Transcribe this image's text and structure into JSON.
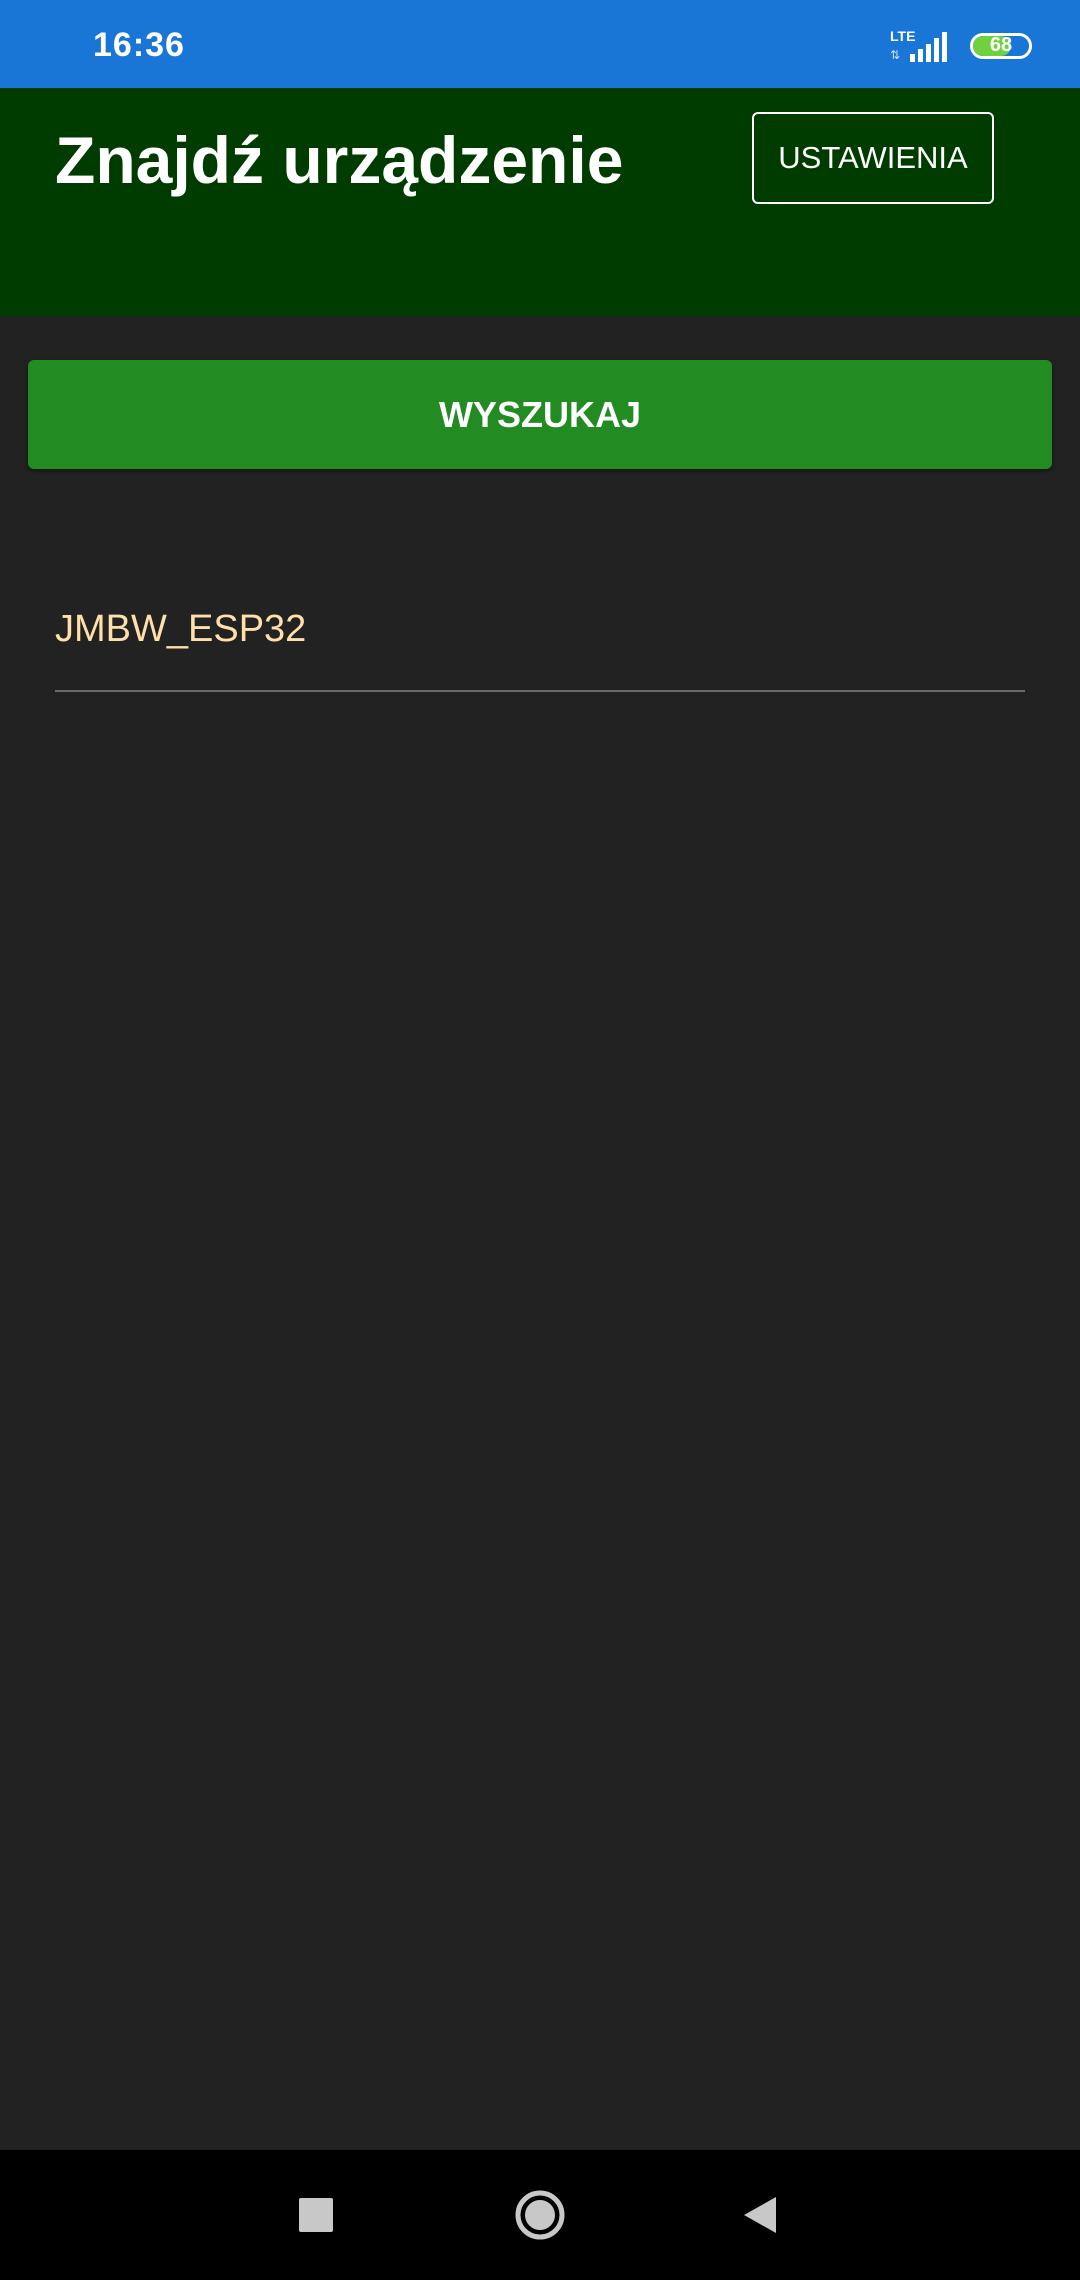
{
  "status_bar": {
    "time": "16:36",
    "network_type": "LTE",
    "data_arrows": "⇅",
    "battery_level": "68",
    "battery_fraction": 0.68,
    "colors": {
      "background": "#1976d6",
      "battery_fill": "#6fd13d"
    },
    "icons": [
      "signal-bars-icon",
      "battery-icon"
    ]
  },
  "header": {
    "title": "Znajdź urządzenie",
    "settings_label": "USTAWIENIA",
    "colors": {
      "background": "#003c00"
    }
  },
  "main": {
    "search_label": "WYSZUKAJ",
    "colors": {
      "search_button": "#228b22",
      "device_text": "#ffdfaa",
      "background": "#222222"
    },
    "devices": [
      {
        "name": "JMBW_ESP32"
      }
    ]
  },
  "navigation_bar": {
    "icons": [
      "recents-square-icon",
      "home-circle-icon",
      "back-triangle-icon"
    ]
  }
}
